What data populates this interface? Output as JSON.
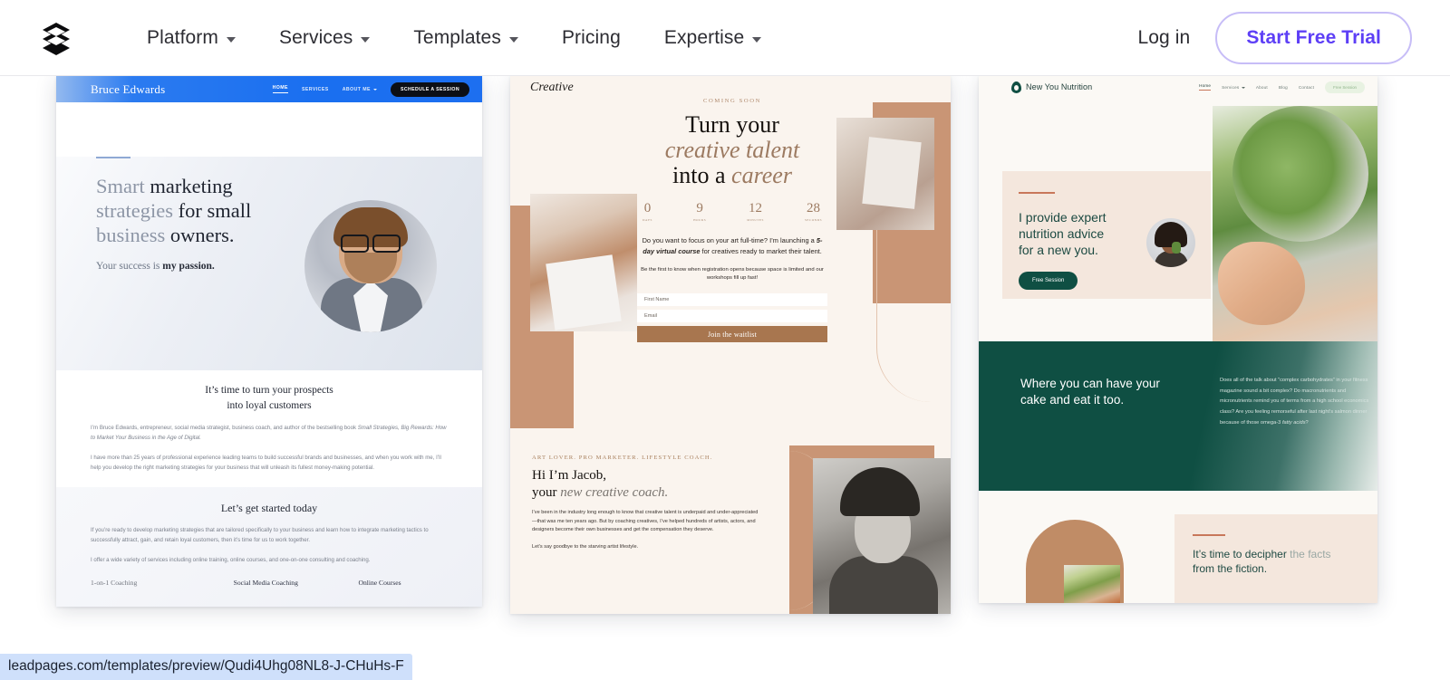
{
  "header": {
    "logo_icon": "stacked-layers-logo",
    "nav": [
      {
        "label": "Platform",
        "has_dropdown": true
      },
      {
        "label": "Services",
        "has_dropdown": true
      },
      {
        "label": "Templates",
        "has_dropdown": true
      },
      {
        "label": "Pricing",
        "has_dropdown": false
      },
      {
        "label": "Expertise",
        "has_dropdown": true
      }
    ],
    "login_label": "Log in",
    "trial_label": "Start Free Trial",
    "accent_color": "#5d3ff6",
    "trial_border_color": "#c7bdf7"
  },
  "templates": [
    {
      "id": "coach",
      "nav": {
        "brand": "Bruce Edwards",
        "links": [
          "HOME",
          "SERVICES",
          "ABOUT ME"
        ],
        "cta": "SCHEDULE A SESSION",
        "bar_color": "#1a6ff0"
      },
      "hero": {
        "heading_light": "Smart ",
        "heading_bold_1": "marketing",
        "heading_line2_light": "strategies",
        "heading_line2_bold": " for small",
        "heading_line3_light": "business",
        "heading_line3_bold": " owners.",
        "subhead_light": "Your success is ",
        "subhead_bold": "my passion."
      },
      "section2": {
        "heading_line1": "It’s time to turn your prospects",
        "heading_line2": "into loyal customers",
        "para1_a": "I’m Bruce Edwards, entrepreneur, social media strategist, business coach, and author of the bestselling book ",
        "para1_italic": "Small Strategies, Big Rewards: How to Market Your Business in the Age of Digital.",
        "para2": "I have more than 25 years of professional experience leading teams to build successful brands and businesses, and when you work with me, I’ll help you develop the right marketing strategies for your business that will unleash its fullest money-making potential."
      },
      "section3": {
        "heading": "Let’s get started today",
        "para1": "If you’re ready to develop marketing strategies that are tailored specifically to your business and learn how to integrate marketing tactics to successfully attract, gain, and retain loyal customers, then it’s time for us to work together.",
        "para2": "I offer a wide variety of services including online training, online courses, and one-on-one consulting and coaching.",
        "columns": [
          "1-on-1 Coaching",
          "Social Media Coaching",
          "Online Courses"
        ]
      }
    },
    {
      "id": "creative",
      "brand": "Creative",
      "kicker": "COMING SOON",
      "heading_line1": "Turn your",
      "heading_line2": "creative talent",
      "heading_line3_a": "into a ",
      "heading_line3_b": "career",
      "countdown": [
        {
          "value": "0",
          "label": "DAYS"
        },
        {
          "value": "9",
          "label": "HOURS"
        },
        {
          "value": "12",
          "label": "MINUTES"
        },
        {
          "value": "28",
          "label": "SECONDS"
        }
      ],
      "body_a": "Do you want to focus on your art full-time? I’m launching a ",
      "body_b": "5-day virtual course",
      "body_c": " for creatives ready to market their talent.",
      "body2": "Be the first to know when registration opens because space is limited and our workshops fill up fast!",
      "form": {
        "first_name_placeholder": "First Name",
        "email_placeholder": "Email",
        "submit_label": "Join the waitlist",
        "submit_color": "#a8764f"
      },
      "lower": {
        "kicker": "ART LOVER. PRO MARKETER. LIFESTYLE COACH.",
        "heading_line1": "Hi I’m Jacob,",
        "heading_line2_a": "your ",
        "heading_line2_b": "new creative coach.",
        "para1": "I’ve been in the industry long enough to know that creative talent is underpaid and under-appreciated—that was me ten years ago. But by coaching creatives, I’ve helped hundreds of artists, actors, and designers become their own businesses and get the compensation they deserve.",
        "para2": "Let’s say goodbye to the starving artist lifestyle."
      },
      "accent_color": "#c99575",
      "bg_color": "#faf4ee"
    },
    {
      "id": "nutrition",
      "nav": {
        "brand": "New You Nutrition",
        "links": [
          "Home",
          "Services",
          "About",
          "Blog",
          "Contact"
        ],
        "cta": "Free Session"
      },
      "hero": {
        "heading_line1": "I provide expert",
        "heading_line2": "nutrition advice",
        "heading_line3": "for a new you.",
        "cta": "Free Session"
      },
      "green_section": {
        "heading_line1": "Where you can have your",
        "heading_line2": "cake and eat it too.",
        "para_a": "Does all of the talk about “complex carbohydrates” in your fitness magazine sound a bit complex? Do macronutrients and micronutrients remind you of terms from a high school economics class? Are you feeling remorseful after last night’s salmon dinner because of those omega-3 ",
        "para_b": "fatty acids",
        "para_c": "?"
      },
      "bottom": {
        "heading_a": "It’s time to decipher ",
        "heading_b": "the facts",
        "heading_c": "from the fiction."
      },
      "green_color": "#0f4f43",
      "tan_color": "#c08c66"
    }
  ],
  "status_bar": {
    "url": "leadpages.com/templates/preview/Qudi4Uhg08NL8-J-CHuHs-F"
  }
}
